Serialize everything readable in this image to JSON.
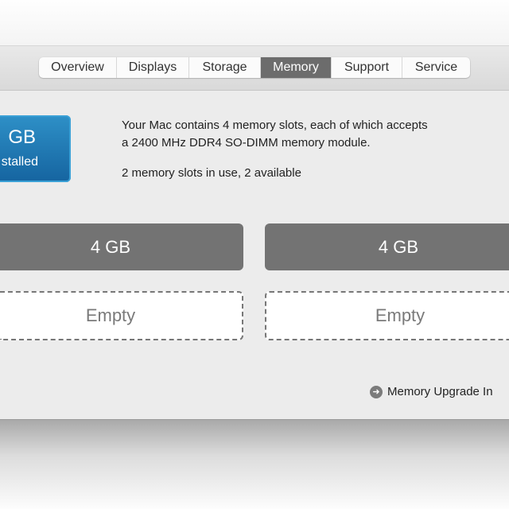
{
  "tabs": [
    {
      "label": "Overview",
      "active": false
    },
    {
      "label": "Displays",
      "active": false
    },
    {
      "label": "Storage",
      "active": false
    },
    {
      "label": "Memory",
      "active": true
    },
    {
      "label": "Support",
      "active": false
    },
    {
      "label": "Service",
      "active": false
    }
  ],
  "badge": {
    "size_text": "GB",
    "installed_text": "stalled",
    "color": "#1f7ab5"
  },
  "description": {
    "line1": "Your Mac contains 4 memory slots, each of which accepts",
    "line2": "a 2400 MHz DDR4 SO-DIMM memory module.",
    "usage": "2 memory slots in use, 2 available"
  },
  "slots": [
    {
      "label": "4 GB",
      "state": "installed"
    },
    {
      "label": "4 GB",
      "state": "installed"
    },
    {
      "label": "Empty",
      "state": "empty"
    },
    {
      "label": "Empty",
      "state": "empty"
    }
  ],
  "link": {
    "label": "Memory Upgrade In",
    "icon": "arrow-right-circle-icon"
  }
}
